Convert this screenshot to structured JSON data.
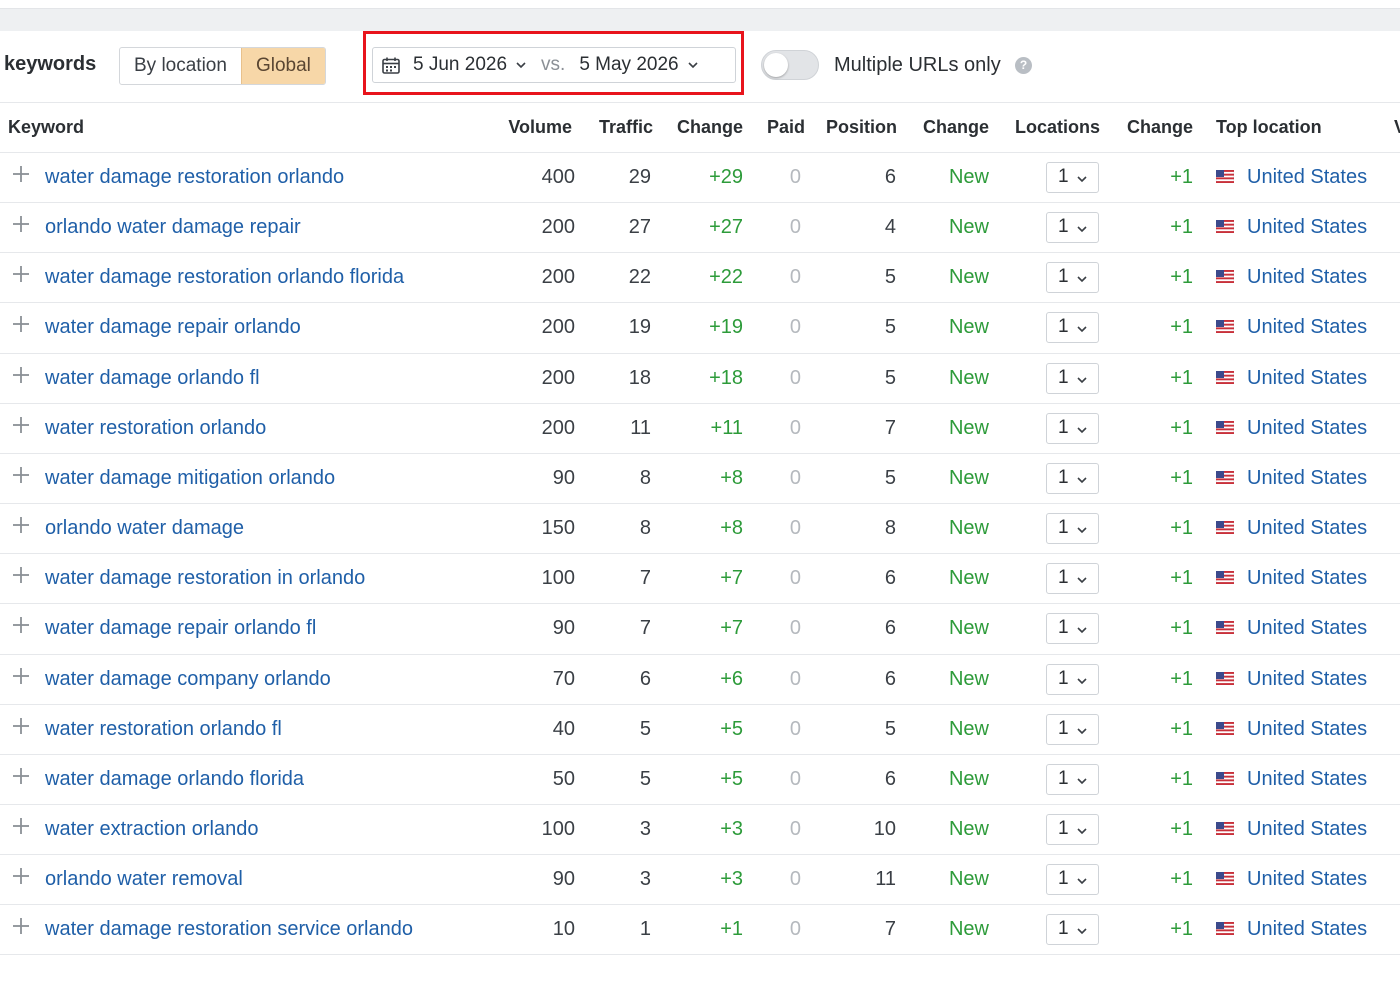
{
  "toolbar": {
    "title": "keywords",
    "segments": [
      "By location",
      "Global"
    ],
    "active_segment": "Global",
    "date_current": "5 Jun 2026",
    "vs_label": "vs.",
    "date_compare": "5 May 2026",
    "toggle_label": "Multiple URLs only",
    "toggle_on": false,
    "help_glyph": "?"
  },
  "table": {
    "headers": {
      "keyword": "Keyword",
      "volume": "Volume",
      "traffic": "Traffic",
      "change": "Change",
      "paid": "Paid",
      "position": "Position",
      "position_change": "Change",
      "locations": "Locations",
      "locations_change": "Change",
      "top_location": "Top location",
      "overflow": "V"
    },
    "rows": [
      {
        "keyword": "water damage restoration orlando",
        "volume": "400",
        "traffic": "29",
        "change": "+29",
        "paid": "0",
        "position": "6",
        "pos_change": "New",
        "locations": "1",
        "loc_change": "+1",
        "top_location": "United States"
      },
      {
        "keyword": "orlando water damage repair",
        "volume": "200",
        "traffic": "27",
        "change": "+27",
        "paid": "0",
        "position": "4",
        "pos_change": "New",
        "locations": "1",
        "loc_change": "+1",
        "top_location": "United States"
      },
      {
        "keyword": "water damage restoration orlando florida",
        "volume": "200",
        "traffic": "22",
        "change": "+22",
        "paid": "0",
        "position": "5",
        "pos_change": "New",
        "locations": "1",
        "loc_change": "+1",
        "top_location": "United States"
      },
      {
        "keyword": "water damage repair orlando",
        "volume": "200",
        "traffic": "19",
        "change": "+19",
        "paid": "0",
        "position": "5",
        "pos_change": "New",
        "locations": "1",
        "loc_change": "+1",
        "top_location": "United States"
      },
      {
        "keyword": "water damage orlando fl",
        "volume": "200",
        "traffic": "18",
        "change": "+18",
        "paid": "0",
        "position": "5",
        "pos_change": "New",
        "locations": "1",
        "loc_change": "+1",
        "top_location": "United States"
      },
      {
        "keyword": "water restoration orlando",
        "volume": "200",
        "traffic": "11",
        "change": "+11",
        "paid": "0",
        "position": "7",
        "pos_change": "New",
        "locations": "1",
        "loc_change": "+1",
        "top_location": "United States"
      },
      {
        "keyword": "water damage mitigation orlando",
        "volume": "90",
        "traffic": "8",
        "change": "+8",
        "paid": "0",
        "position": "5",
        "pos_change": "New",
        "locations": "1",
        "loc_change": "+1",
        "top_location": "United States"
      },
      {
        "keyword": "orlando water damage",
        "volume": "150",
        "traffic": "8",
        "change": "+8",
        "paid": "0",
        "position": "8",
        "pos_change": "New",
        "locations": "1",
        "loc_change": "+1",
        "top_location": "United States"
      },
      {
        "keyword": "water damage restoration in orlando",
        "volume": "100",
        "traffic": "7",
        "change": "+7",
        "paid": "0",
        "position": "6",
        "pos_change": "New",
        "locations": "1",
        "loc_change": "+1",
        "top_location": "United States"
      },
      {
        "keyword": "water damage repair orlando fl",
        "volume": "90",
        "traffic": "7",
        "change": "+7",
        "paid": "0",
        "position": "6",
        "pos_change": "New",
        "locations": "1",
        "loc_change": "+1",
        "top_location": "United States"
      },
      {
        "keyword": "water damage company orlando",
        "volume": "70",
        "traffic": "6",
        "change": "+6",
        "paid": "0",
        "position": "6",
        "pos_change": "New",
        "locations": "1",
        "loc_change": "+1",
        "top_location": "United States"
      },
      {
        "keyword": "water restoration orlando fl",
        "volume": "40",
        "traffic": "5",
        "change": "+5",
        "paid": "0",
        "position": "5",
        "pos_change": "New",
        "locations": "1",
        "loc_change": "+1",
        "top_location": "United States"
      },
      {
        "keyword": "water damage orlando florida",
        "volume": "50",
        "traffic": "5",
        "change": "+5",
        "paid": "0",
        "position": "6",
        "pos_change": "New",
        "locations": "1",
        "loc_change": "+1",
        "top_location": "United States"
      },
      {
        "keyword": "water extraction orlando",
        "volume": "100",
        "traffic": "3",
        "change": "+3",
        "paid": "0",
        "position": "10",
        "pos_change": "New",
        "locations": "1",
        "loc_change": "+1",
        "top_location": "United States"
      },
      {
        "keyword": "orlando water removal",
        "volume": "90",
        "traffic": "3",
        "change": "+3",
        "paid": "0",
        "position": "11",
        "pos_change": "New",
        "locations": "1",
        "loc_change": "+1",
        "top_location": "United States"
      },
      {
        "keyword": "water damage restoration service orlando",
        "volume": "10",
        "traffic": "1",
        "change": "+1",
        "paid": "0",
        "position": "7",
        "pos_change": "New",
        "locations": "1",
        "loc_change": "+1",
        "top_location": "United States"
      }
    ]
  },
  "colors": {
    "link": "#1f5fa8",
    "positive": "#2d9b3a",
    "highlight_box": "#e8141c",
    "active_segment_bg": "#f7d7a8"
  },
  "icons": {
    "date_picker": "calendar-icon",
    "dropdown": "chevron-down-icon",
    "help": "help-icon",
    "row_expand": "plus-icon",
    "country": "us-flag-icon"
  }
}
